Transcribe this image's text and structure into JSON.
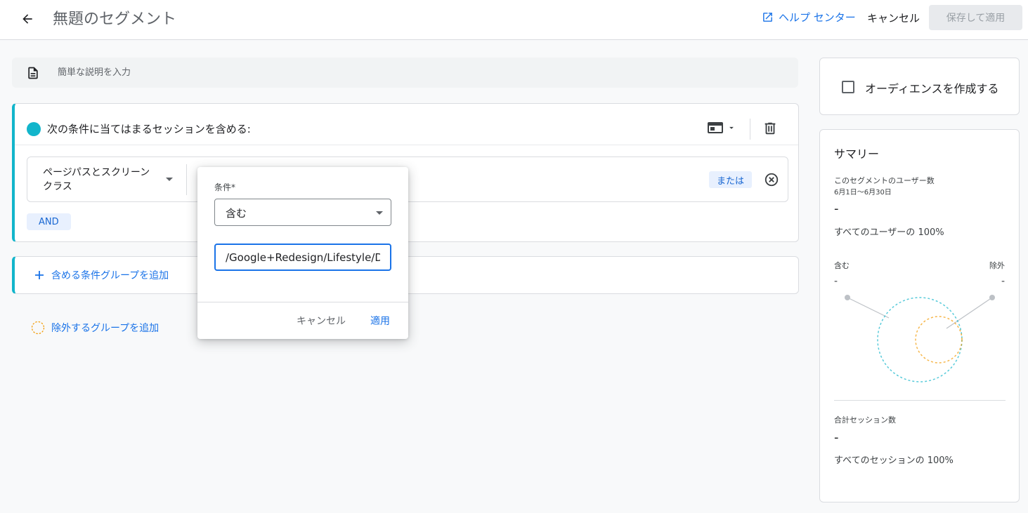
{
  "header": {
    "title": "無題のセグメント",
    "help_label": "ヘルプ センター",
    "cancel_label": "キャンセル",
    "save_label": "保存して適用"
  },
  "description": {
    "placeholder": "簡単な説明を入力"
  },
  "include_group": {
    "title": "次の条件に当てはまるセッションを含める:",
    "condition": {
      "dimension": "ページパスとスクリーン クラス",
      "or_label": "または"
    },
    "and_label": "AND"
  },
  "add_include_group_label": "含める条件グループを追加",
  "add_exclude_group_label": "除外するグループを追加",
  "audience": {
    "label": "オーディエンスを作成する",
    "checked": false
  },
  "summary": {
    "title": "サマリー",
    "users_label": "このセグメントのユーザー数",
    "date_range": "6月1日～6月30日",
    "users_value": "-",
    "users_percent": "すべてのユーザーの 100%",
    "include_label": "含む",
    "exclude_label": "除外",
    "include_value": "-",
    "exclude_value": "-",
    "sessions_label": "合計セッション数",
    "sessions_value": "-",
    "sessions_percent": "すべてのセッションの 100%"
  },
  "popup": {
    "label": "条件*",
    "match_type": "含む",
    "value": "/Google+Redesign/Lifestyle/Drinkware",
    "cancel_label": "キャンセル",
    "apply_label": "適用"
  },
  "colors": {
    "accent": "#1a73e8",
    "include": "#12b5cb",
    "exclude": "#f29900"
  }
}
